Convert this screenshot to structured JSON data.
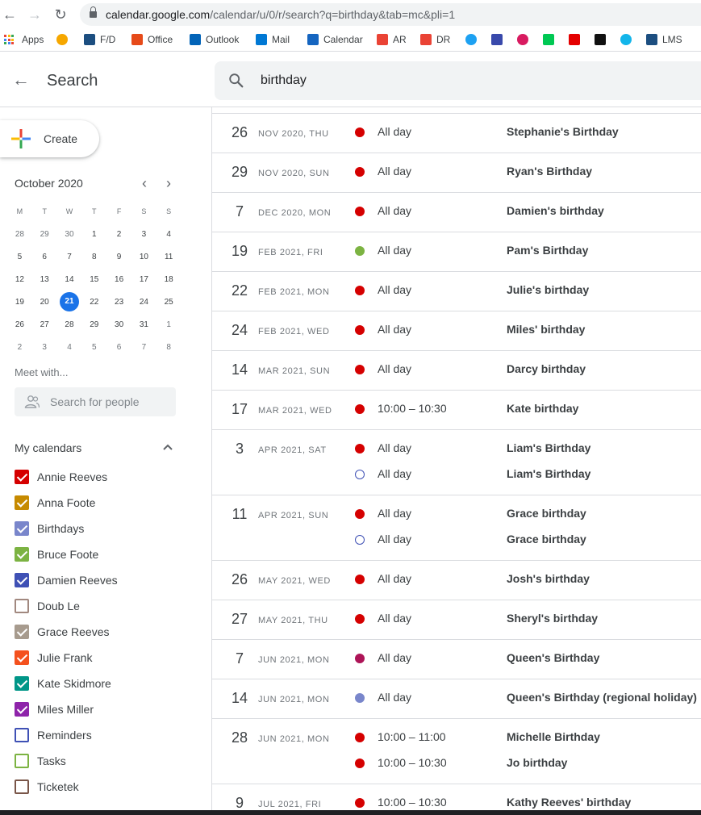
{
  "browser": {
    "url_main": "calendar.google.com",
    "url_rest": "/calendar/u/0/r/search?q=birthday&tab=mc&pli=1",
    "bookmarks": [
      {
        "label": "Apps",
        "icon": "apps-grid-icon"
      },
      {
        "label": "",
        "icon": "lightning-icon",
        "color": "#f6a700"
      },
      {
        "label": "F/D",
        "icon": "chart-icon",
        "color": "#1c4e80"
      },
      {
        "label": "Office",
        "icon": "office-icon",
        "color": "#e64a19"
      },
      {
        "label": "Outlook",
        "icon": "outlook-icon",
        "color": "#0364b8"
      },
      {
        "label": "Mail",
        "icon": "mail-icon",
        "color": "#0078d4"
      },
      {
        "label": "Calendar",
        "icon": "calendar-icon",
        "color": "#1565c0"
      },
      {
        "label": "AR",
        "icon": "gmail-icon",
        "color": "#ea4335"
      },
      {
        "label": "DR",
        "icon": "gmail-icon",
        "color": "#ea4335"
      },
      {
        "label": "",
        "icon": "twitter-icon",
        "color": "#1da1f2"
      },
      {
        "label": "",
        "icon": "flag-icon",
        "color": "#3949ab"
      },
      {
        "label": "",
        "icon": "phone-icon",
        "color": "#d81b60"
      },
      {
        "label": "",
        "icon": "check-icon",
        "color": "#00c853"
      },
      {
        "label": "",
        "icon": "kangaroo-icon",
        "color": "#e40000"
      },
      {
        "label": "",
        "icon": "a-logo-icon",
        "color": "#111111"
      },
      {
        "label": "",
        "icon": "xero-icon",
        "color": "#13b5ea"
      },
      {
        "label": "LMS",
        "icon": "chart-icon",
        "color": "#1c4e80"
      }
    ]
  },
  "header": {
    "title": "Search",
    "query": "birthday"
  },
  "sidebar": {
    "create_label": "Create",
    "mini_month": "October 2020",
    "weekdays": [
      "M",
      "T",
      "W",
      "T",
      "F",
      "S",
      "S"
    ],
    "weeks": [
      [
        "28",
        "29",
        "30",
        "1",
        "2",
        "3",
        "4"
      ],
      [
        "5",
        "6",
        "7",
        "8",
        "9",
        "10",
        "11"
      ],
      [
        "12",
        "13",
        "14",
        "15",
        "16",
        "17",
        "18"
      ],
      [
        "19",
        "20",
        "21",
        "22",
        "23",
        "24",
        "25"
      ],
      [
        "26",
        "27",
        "28",
        "29",
        "30",
        "31",
        "1"
      ],
      [
        "2",
        "3",
        "4",
        "5",
        "6",
        "7",
        "8"
      ]
    ],
    "meet_title": "Meet with...",
    "people_placeholder": "Search for people",
    "my_calendars_title": "My calendars",
    "calendars": [
      {
        "name": "Annie Reeves",
        "color": "#d50000",
        "checked": true
      },
      {
        "name": "Anna Foote",
        "color": "#c68a00",
        "checked": true
      },
      {
        "name": "Birthdays",
        "color": "#7986cb",
        "checked": true
      },
      {
        "name": "Bruce Foote",
        "color": "#7cb342",
        "checked": true
      },
      {
        "name": "Damien Reeves",
        "color": "#3f51b5",
        "checked": true
      },
      {
        "name": "Doub Le",
        "color": "#a1887f",
        "checked": false
      },
      {
        "name": "Grace Reeves",
        "color": "#a79b8e",
        "checked": true
      },
      {
        "name": "Julie Frank",
        "color": "#f4511e",
        "checked": true
      },
      {
        "name": "Kate Skidmore",
        "color": "#009688",
        "checked": true
      },
      {
        "name": "Miles Miller",
        "color": "#8e24aa",
        "checked": true
      },
      {
        "name": "Reminders",
        "color": "#3f51b5",
        "checked": false
      },
      {
        "name": "Tasks",
        "color": "#7cb342",
        "checked": false
      },
      {
        "name": "Ticketek",
        "color": "#795548",
        "checked": false
      }
    ]
  },
  "results": [
    {
      "day": "26",
      "date": "NOV 2020, THU",
      "events": [
        {
          "time": "All day",
          "title": "Stephanie's Birthday",
          "color": "#d50000",
          "hollow": false
        }
      ]
    },
    {
      "day": "29",
      "date": "NOV 2020, SUN",
      "events": [
        {
          "time": "All day",
          "title": "Ryan's Birthday",
          "color": "#d50000",
          "hollow": false
        }
      ]
    },
    {
      "day": "7",
      "date": "DEC 2020, MON",
      "events": [
        {
          "time": "All day",
          "title": "Damien's birthday",
          "color": "#d50000",
          "hollow": false
        }
      ]
    },
    {
      "day": "19",
      "date": "FEB 2021, FRI",
      "events": [
        {
          "time": "All day",
          "title": "Pam's Birthday",
          "color": "#7cb342",
          "hollow": false
        }
      ]
    },
    {
      "day": "22",
      "date": "FEB 2021, MON",
      "events": [
        {
          "time": "All day",
          "title": "Julie's birthday",
          "color": "#d50000",
          "hollow": false
        }
      ]
    },
    {
      "day": "24",
      "date": "FEB 2021, WED",
      "events": [
        {
          "time": "All day",
          "title": "Miles' birthday",
          "color": "#d50000",
          "hollow": false
        }
      ]
    },
    {
      "day": "14",
      "date": "MAR 2021, SUN",
      "events": [
        {
          "time": "All day",
          "title": "Darcy birthday",
          "color": "#d50000",
          "hollow": false
        }
      ]
    },
    {
      "day": "17",
      "date": "MAR 2021, WED",
      "events": [
        {
          "time": "10:00 – 10:30",
          "title": "Kate birthday",
          "color": "#d50000",
          "hollow": false
        }
      ]
    },
    {
      "day": "3",
      "date": "APR 2021, SAT",
      "events": [
        {
          "time": "All day",
          "title": "Liam's Birthday",
          "color": "#d50000",
          "hollow": false
        },
        {
          "time": "All day",
          "title": "Liam's Birthday",
          "color": "#3f51b5",
          "hollow": true
        }
      ]
    },
    {
      "day": "11",
      "date": "APR 2021, SUN",
      "events": [
        {
          "time": "All day",
          "title": "Grace birthday",
          "color": "#d50000",
          "hollow": false
        },
        {
          "time": "All day",
          "title": "Grace birthday",
          "color": "#3f51b5",
          "hollow": true
        }
      ]
    },
    {
      "day": "26",
      "date": "MAY 2021, WED",
      "events": [
        {
          "time": "All day",
          "title": "Josh's birthday",
          "color": "#d50000",
          "hollow": false
        }
      ]
    },
    {
      "day": "27",
      "date": "MAY 2021, THU",
      "events": [
        {
          "time": "All day",
          "title": "Sheryl's birthday",
          "color": "#d50000",
          "hollow": false
        }
      ]
    },
    {
      "day": "7",
      "date": "JUN 2021, MON",
      "events": [
        {
          "time": "All day",
          "title": "Queen's Birthday",
          "color": "#ad1457",
          "hollow": false
        }
      ]
    },
    {
      "day": "14",
      "date": "JUN 2021, MON",
      "events": [
        {
          "time": "All day",
          "title": "Queen's Birthday (regional holiday)",
          "color": "#7986cb",
          "hollow": false
        }
      ]
    },
    {
      "day": "28",
      "date": "JUN 2021, MON",
      "events": [
        {
          "time": "10:00 – 11:00",
          "title": "Michelle Birthday",
          "color": "#d50000",
          "hollow": false
        },
        {
          "time": "10:00 – 10:30",
          "title": "Jo birthday",
          "color": "#d50000",
          "hollow": false
        }
      ]
    },
    {
      "day": "9",
      "date": "JUL 2021, FRI",
      "events": [
        {
          "time": "10:00 – 10:30",
          "title": "Kathy Reeves' birthday",
          "color": "#d50000",
          "hollow": false
        }
      ]
    }
  ]
}
